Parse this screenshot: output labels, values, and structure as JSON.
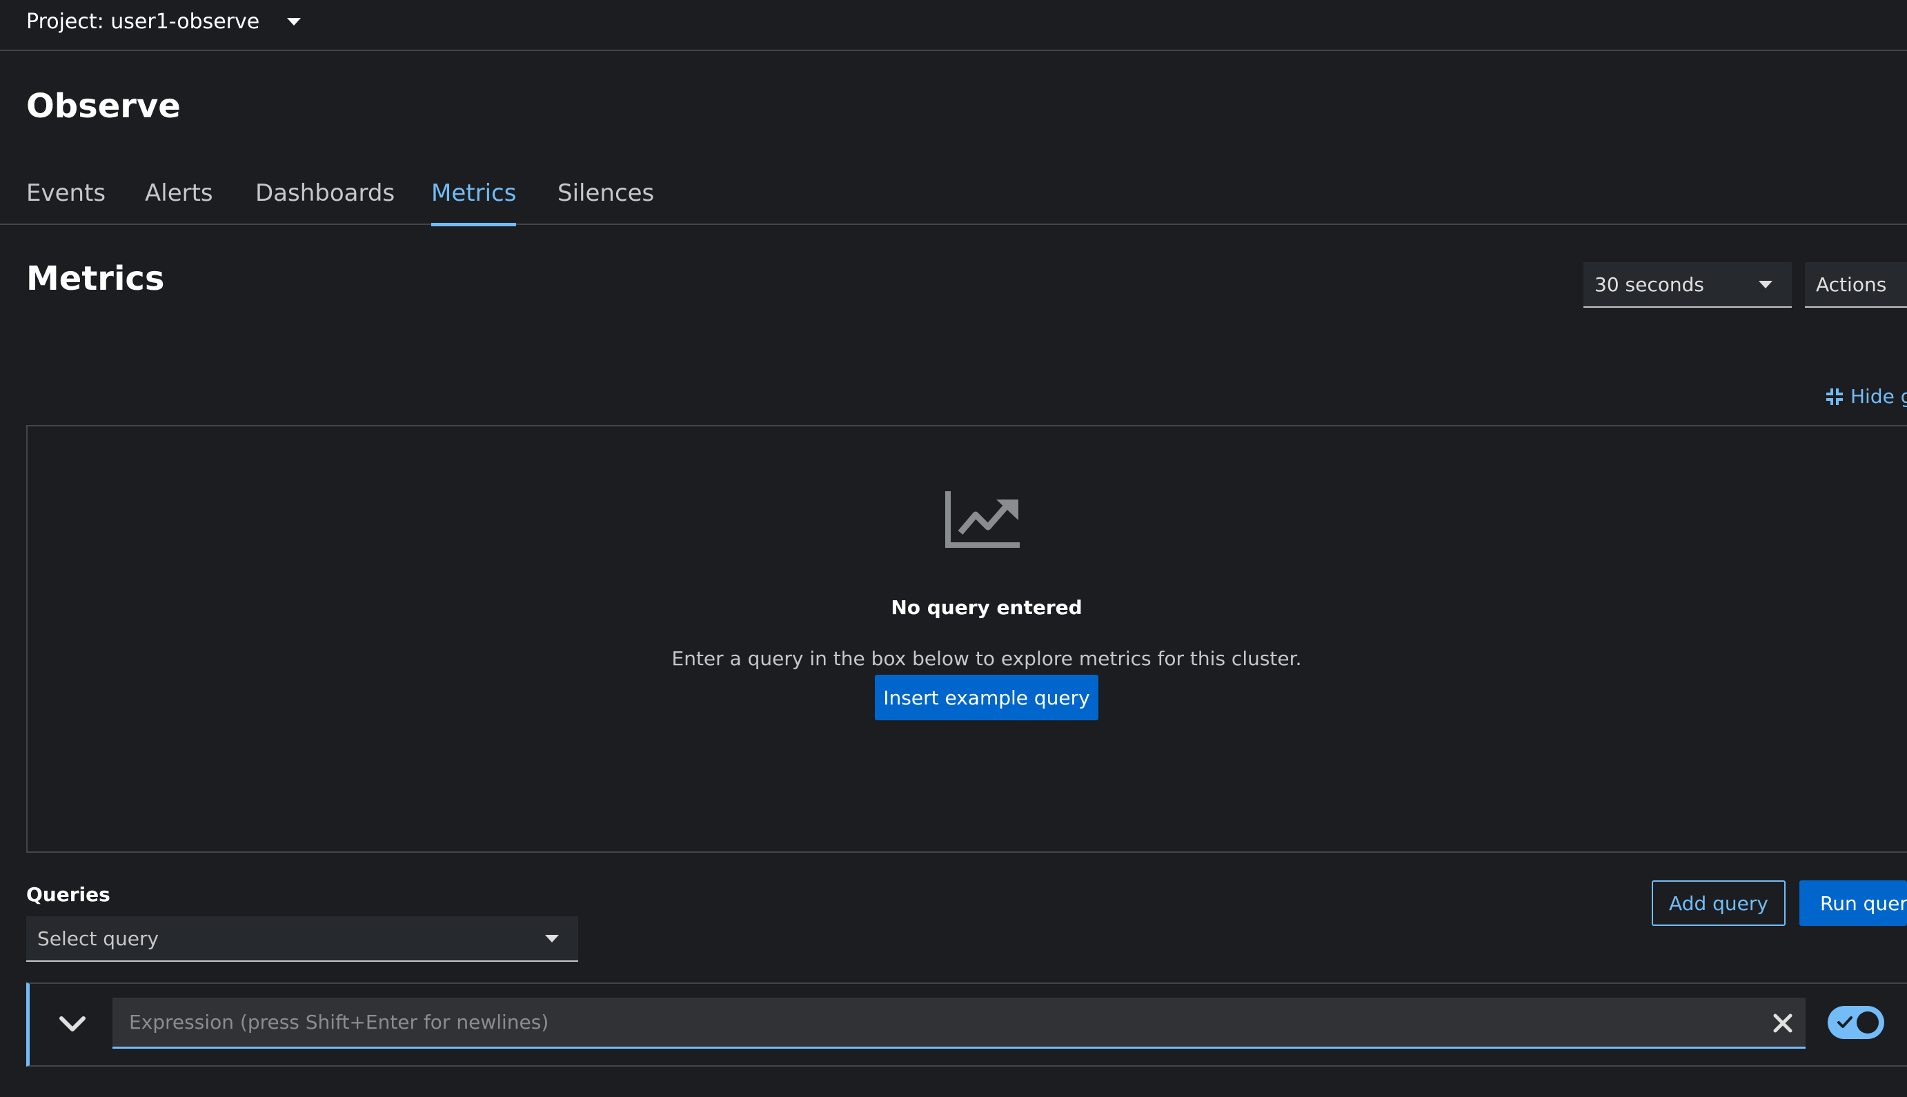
{
  "project": {
    "label": "Project: user1-observe"
  },
  "page": {
    "title": "Observe"
  },
  "tabs": [
    {
      "label": "Events"
    },
    {
      "label": "Alerts"
    },
    {
      "label": "Dashboards"
    },
    {
      "label": "Metrics",
      "active": true
    },
    {
      "label": "Silences"
    }
  ],
  "metrics": {
    "title": "Metrics",
    "refresh_interval": "30 seconds",
    "actions_label": "Actions",
    "hide_graph_label": "Hide g"
  },
  "empty_state": {
    "icon": "chart-line-icon",
    "title": "No query entered",
    "body": "Enter a query in the box below to explore metrics for this cluster.",
    "button": "Insert example query"
  },
  "queries": {
    "label": "Queries",
    "select_placeholder": "Select query",
    "add_query": "Add query",
    "run_queries": "Run querie",
    "expression_placeholder": "Expression (press Shift+Enter for newlines)",
    "toggle_on": true
  },
  "colors": {
    "background": "#1b1d21",
    "accent": "#73bcf7",
    "primary_button": "#0066cc",
    "border": "#444548"
  }
}
